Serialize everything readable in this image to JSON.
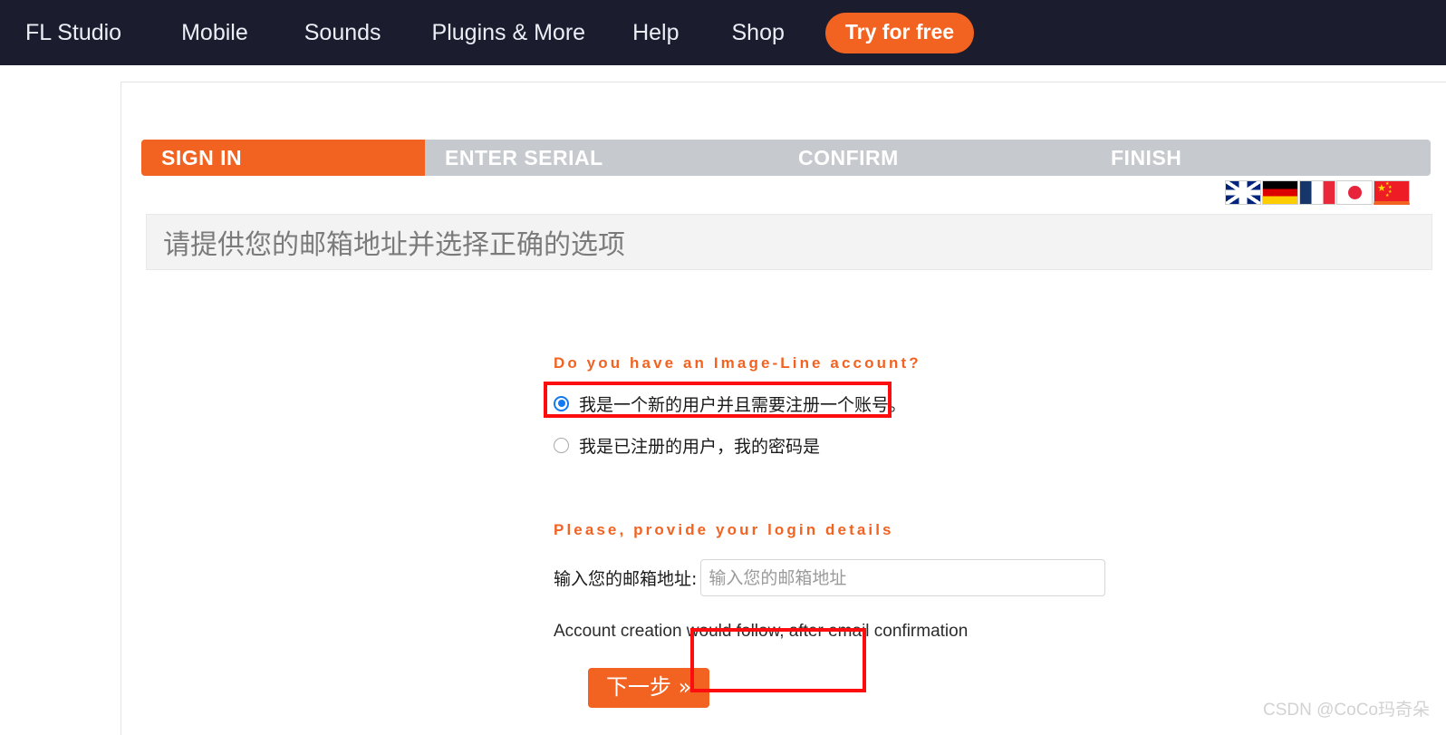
{
  "topnav": {
    "items": [
      {
        "label": "FL Studio",
        "name": "nav-fl-studio"
      },
      {
        "label": "Mobile",
        "name": "nav-mobile"
      },
      {
        "label": "Sounds",
        "name": "nav-sounds"
      },
      {
        "label": "Plugins & More",
        "name": "nav-plugins"
      },
      {
        "label": "Help",
        "name": "nav-help"
      },
      {
        "label": "Shop",
        "name": "nav-shop"
      }
    ],
    "cta_label": "Try for free",
    "background_color": "#1b1c2e",
    "accent_color": "#f26322"
  },
  "steps": {
    "tabs": [
      {
        "label": "SIGN IN",
        "active": true
      },
      {
        "label": "ENTER SERIAL",
        "active": false
      },
      {
        "label": "CONFIRM",
        "active": false
      },
      {
        "label": "FINISH",
        "active": false
      }
    ],
    "active_color": "#f26322",
    "inactive_color": "#c6cace"
  },
  "languages": {
    "options": [
      {
        "code": "uk",
        "name": "flag-uk-icon",
        "selected": false
      },
      {
        "code": "de",
        "name": "flag-germany-icon",
        "selected": false
      },
      {
        "code": "fr",
        "name": "flag-france-icon",
        "selected": false
      },
      {
        "code": "jp",
        "name": "flag-japan-icon",
        "selected": false
      },
      {
        "code": "cn",
        "name": "flag-china-icon",
        "selected": true
      }
    ]
  },
  "page": {
    "heading": "请提供您的邮箱地址并选择正确的选项"
  },
  "form": {
    "account_question": "Do you have an Image-Line account?",
    "options": [
      {
        "label": "我是一个新的用户并且需要注册一个账号。",
        "selected": true
      },
      {
        "label": "我是已注册的用户，我的密码是",
        "selected": false
      }
    ],
    "login_details_title": "Please, provide your login details",
    "email_label": "输入您的邮箱地址:",
    "email_value": "",
    "email_placeholder": "输入您的邮箱地址",
    "helper_text": "Account creation would follow, after email confirmation",
    "submit_label": "下一步 »"
  },
  "annotations": {
    "color": "#fd0d0d",
    "boxes": [
      "new-user-radio-option",
      "next-step-button"
    ]
  },
  "watermark": {
    "text": "CSDN @CoCo玛奇朵"
  }
}
